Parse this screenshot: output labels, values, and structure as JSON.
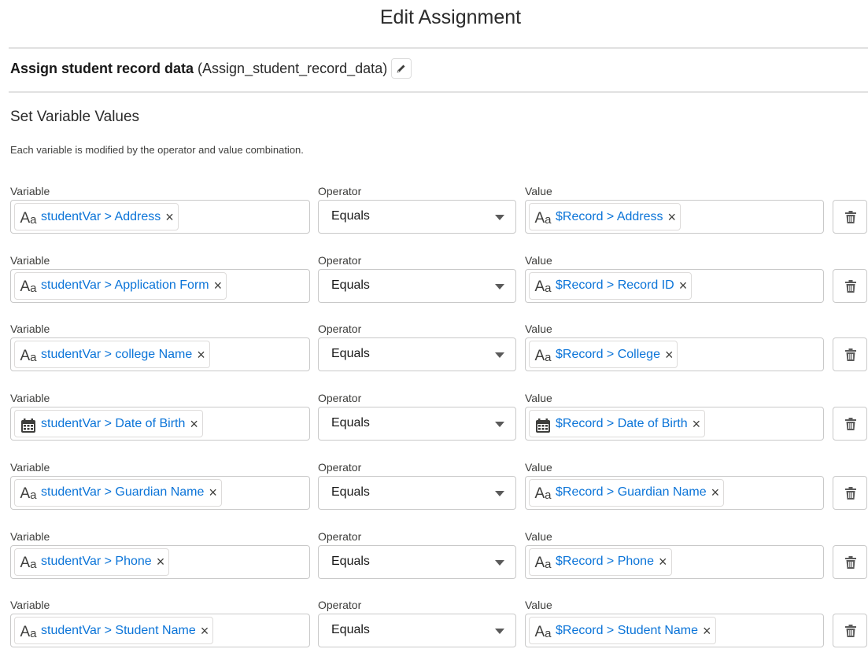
{
  "modal": {
    "title": "Edit Assignment"
  },
  "element": {
    "label": "Assign student record data",
    "api_name": "(Assign_student_record_data)"
  },
  "section": {
    "title": "Set Variable Values",
    "help": "Each variable is modified by the operator and value combination."
  },
  "labels": {
    "variable": "Variable",
    "operator": "Operator",
    "value": "Value"
  },
  "rows": [
    {
      "variable": "studentVar > Address",
      "variable_icon": "text-icon",
      "operator": "Equals",
      "value": "$Record > Address",
      "value_icon": "text-icon"
    },
    {
      "variable": "studentVar > Application Form",
      "variable_icon": "text-icon",
      "operator": "Equals",
      "value": "$Record > Record ID",
      "value_icon": "text-icon"
    },
    {
      "variable": "studentVar > college Name",
      "variable_icon": "text-icon",
      "operator": "Equals",
      "value": "$Record > College",
      "value_icon": "text-icon"
    },
    {
      "variable": "studentVar > Date of Birth",
      "variable_icon": "calendar-icon",
      "operator": "Equals",
      "value": "$Record > Date of Birth",
      "value_icon": "calendar-icon"
    },
    {
      "variable": "studentVar > Guardian Name",
      "variable_icon": "text-icon",
      "operator": "Equals",
      "value": "$Record > Guardian Name",
      "value_icon": "text-icon"
    },
    {
      "variable": "studentVar > Phone",
      "variable_icon": "text-icon",
      "operator": "Equals",
      "value": "$Record > Phone",
      "value_icon": "text-icon"
    },
    {
      "variable": "studentVar > Student Name",
      "variable_icon": "text-icon",
      "operator": "Equals",
      "value": "$Record > Student Name",
      "value_icon": "text-icon"
    }
  ],
  "icons": {
    "remove": "×",
    "edit": "pencil-icon",
    "delete": "trash-icon",
    "dropdown": "caret-down-icon"
  },
  "colors": {
    "link": "#0b74d8",
    "border": "#c9c9c9",
    "divider": "#e1e1e1"
  }
}
